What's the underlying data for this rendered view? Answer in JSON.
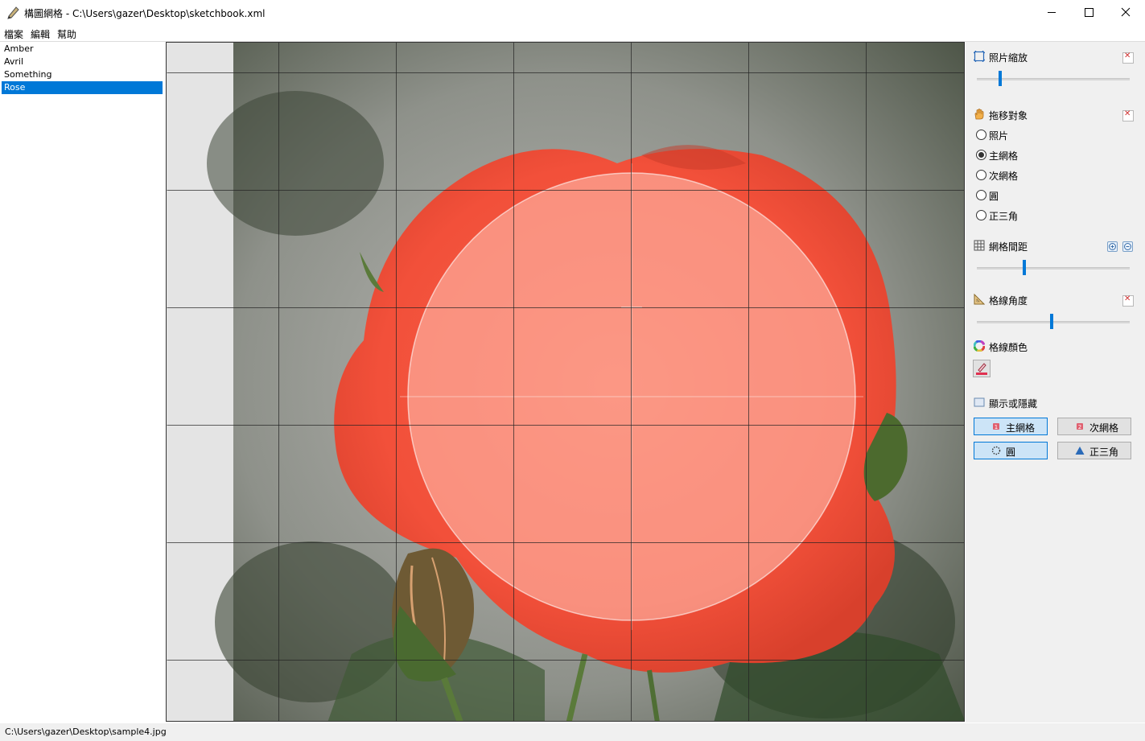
{
  "window": {
    "title": "構圖網格 - C:\\Users\\gazer\\Desktop\\sketchbook.xml",
    "app_icon": "pencil-icon"
  },
  "menu": [
    "檔案",
    "編輯",
    "幫助"
  ],
  "list": {
    "items": [
      "Amber",
      "Avril",
      "Something",
      "Rose"
    ],
    "selected_index": 3
  },
  "canvas": {
    "image": "rose-photo",
    "overlay_circle": true,
    "main_grid": true,
    "sub_grid": false
  },
  "panel": {
    "zoom": {
      "title": "照片縮放",
      "icon": "zoom-frame-icon",
      "slider_value": 0.15
    },
    "drag_target": {
      "title": "拖移對象",
      "icon": "hand-icon",
      "options": [
        "照片",
        "主網格",
        "次網格",
        "圓",
        "正三角"
      ],
      "selected_index": 1
    },
    "grid_spacing": {
      "title": "網格間距",
      "icon": "grid-icon",
      "slider_value": 0.31
    },
    "line_angle": {
      "title": "格線角度",
      "icon": "ruler-triangle-icon",
      "slider_value": 0.49
    },
    "line_color": {
      "title": "格線顏色",
      "icon": "color-wheel-icon",
      "swatch_icon": "pen-color-icon",
      "color": "#e03050"
    },
    "visibility": {
      "title": "顯示或隱藏",
      "icon": "display-icon",
      "buttons": [
        {
          "label": "主網格",
          "icon": "main-grid-icon",
          "active": true
        },
        {
          "label": "次網格",
          "icon": "sub-grid-icon",
          "active": false
        },
        {
          "label": "圓",
          "icon": "circle-dotted-icon",
          "active": true
        },
        {
          "label": "正三角",
          "icon": "triangle-icon",
          "active": false
        }
      ]
    }
  },
  "status": {
    "path": "C:\\Users\\gazer\\Desktop\\sample4.jpg"
  }
}
